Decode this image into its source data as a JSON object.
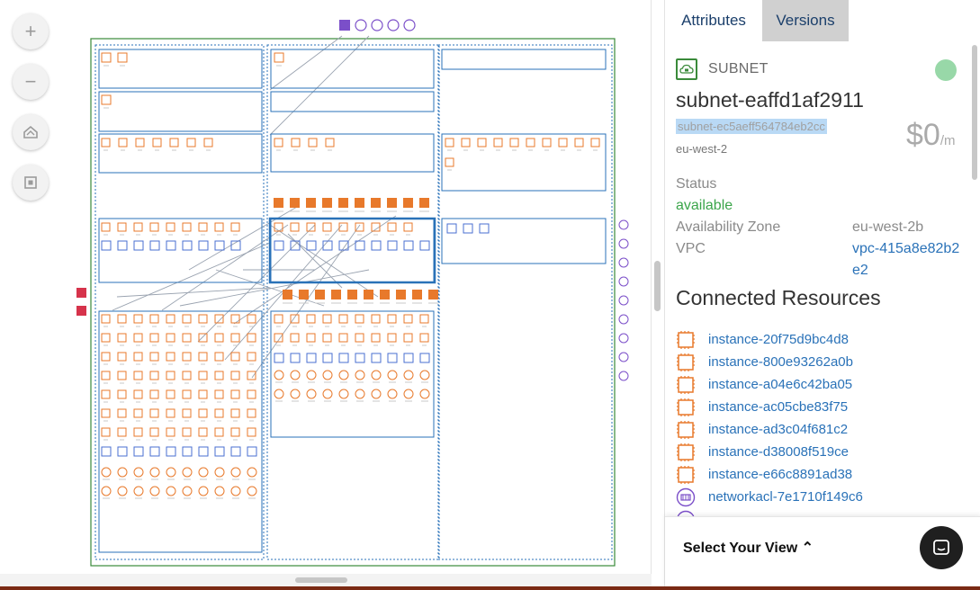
{
  "canvas": {
    "zoom_controls": [
      {
        "name": "zoom-in-button",
        "glyph": "+",
        "icon": "plus-icon"
      },
      {
        "name": "zoom-out-button",
        "glyph": "−",
        "icon": "minus-icon"
      },
      {
        "name": "layout-button",
        "glyph": "⛶",
        "icon": "layout-icon"
      },
      {
        "name": "fit-view-button",
        "glyph": "▣",
        "icon": "fit-view-icon"
      }
    ]
  },
  "panel": {
    "tabs": [
      {
        "label": "Attributes",
        "active": true
      },
      {
        "label": "Versions",
        "active": false
      }
    ],
    "resource_type": "SUBNET",
    "resource_name": "subnet-eaffd1af2911",
    "resource_id": "subnet-ec5aeff564784eb2cc",
    "region": "eu-west-2",
    "price": "$0",
    "price_unit": "/m",
    "attributes": {
      "status_label": "Status",
      "status_value": "available",
      "az_label": "Availability Zone",
      "az_value": "eu-west-2b",
      "vpc_label": "VPC",
      "vpc_value_line1": "vpc-415a8e82b2",
      "vpc_value_line2": "e2"
    },
    "connected_title": "Connected Resources",
    "connected": [
      {
        "label": "instance-20f75d9bc4d8",
        "icon": "instance-icon"
      },
      {
        "label": "instance-800e93262a0b",
        "icon": "instance-icon"
      },
      {
        "label": "instance-a04e6c42ba05",
        "icon": "instance-icon"
      },
      {
        "label": "instance-ac05cbe83f75",
        "icon": "instance-icon"
      },
      {
        "label": "instance-ad3c04f681c2",
        "icon": "instance-icon"
      },
      {
        "label": "instance-d38008f519ce",
        "icon": "instance-icon"
      },
      {
        "label": "instance-e66c8891ad38",
        "icon": "instance-icon"
      },
      {
        "label": "networkacl-7e1710f149c6",
        "icon": "network-acl-icon"
      },
      {
        "label": "",
        "icon": "route-table-icon"
      }
    ],
    "select_view_label": "Select Your View ⌃",
    "colors": {
      "accent_blue": "#2a72b8",
      "status_green": "#3ba54a",
      "instance_orange": "#e8792b",
      "subnet_green": "#3a8a3a",
      "acl_purple": "#7b4fc9"
    }
  }
}
